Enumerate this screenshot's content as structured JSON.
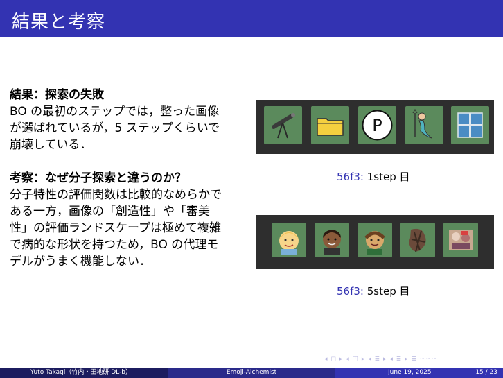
{
  "slide": {
    "title": "結果と考察"
  },
  "left": {
    "result_heading": "結果：探索の失敗",
    "result_lines": [
      "BO の最初のステップでは，整った画像",
      "が選ばれているが，5 ステップくらいで",
      "崩壊している．"
    ],
    "discussion_heading": "考察：なぜ分子探索と違うのか？",
    "discussion_lines": [
      "分子特性の評価関数は比較的なめらかで",
      "ある一方，画像の「創造性」や「審美",
      "性」の評価ランドスケープは極めて複雑",
      "で病的な形状を持つため，BO の代理モ",
      "デルがうまく機能しない．"
    ]
  },
  "figures": [
    {
      "tag": "56f3:",
      "caption": "1step 目",
      "tiles": [
        "telescope-emoji",
        "folder-emoji",
        "parking-emoji",
        "merperson-emoji",
        "windows-emoji"
      ]
    },
    {
      "tag": "56f3:",
      "caption": "5step 目",
      "tiles": [
        "face-emoji-blonde",
        "face-emoji-dark",
        "face-emoji-green",
        "distorted-emoji",
        "distorted-emoji-2"
      ]
    }
  ],
  "nav": {
    "symbols": "◂ ◻ ▸  ◂ ◰ ▸  ◂ ≣ ▸  ◂ ≣ ▸   ≣   ∽∽∽"
  },
  "footer": {
    "author": "Yuto Takagi（竹内・田地研 DL-b）",
    "short_title": "Emoji-Alchemist",
    "date": "June 19, 2025",
    "page": "15 / 23"
  },
  "colors": {
    "theme": "#3333b2",
    "tile_bg": "#5b8a5c",
    "strip_bg": "#2e2e2e"
  }
}
